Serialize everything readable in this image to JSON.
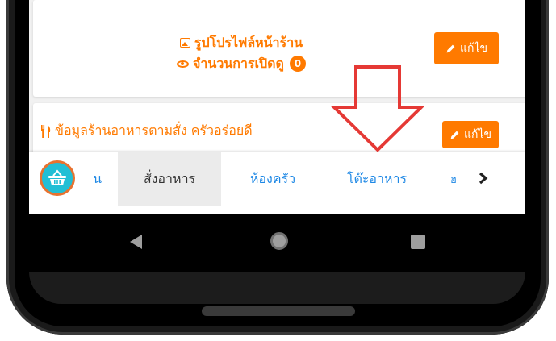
{
  "profile_card": {
    "photo_link": "รูปโปรไฟล์หน้าร้าน",
    "views_label": "จำนวนการเปิดดู",
    "views_count": "0",
    "edit_label": "แก้ไข"
  },
  "restaurant_card": {
    "title": "ข้อมูลร้านอาหารตามสั่ง ครัวอร่อยดี",
    "edit_label": "แก้ไข"
  },
  "tabs": {
    "home_partial": "น",
    "order": "สั่งอาหาร",
    "kitchen": "ห้องครัว",
    "table": "โต๊ะอาหาร",
    "more_partial": "ฮ"
  },
  "colors": {
    "accent": "#ff7a00",
    "tab_text": "#1e88e5",
    "arrow": "#e53935",
    "fab": "#22bfd5"
  },
  "icons": [
    "image-icon",
    "eye-icon",
    "pencil-icon",
    "fork-knife-icon",
    "basket-icon",
    "chevron-right-icon",
    "back-icon",
    "home-icon",
    "recents-icon",
    "down-arrow-annotation"
  ]
}
